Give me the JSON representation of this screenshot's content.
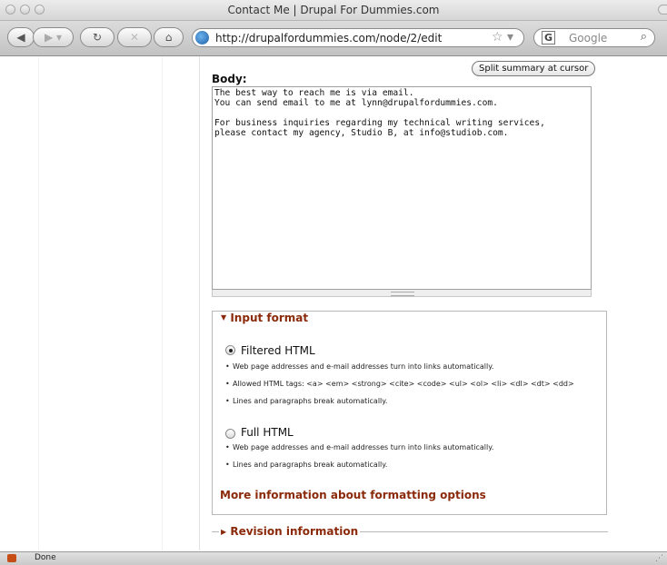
{
  "window": {
    "title": "Contact Me | Drupal For Dummies.com"
  },
  "toolbar": {
    "back_icon": "back-arrow-icon",
    "forward_icon": "forward-arrow-icon",
    "reload_icon": "reload-icon",
    "stop_icon": "stop-icon",
    "home_icon": "home-icon",
    "url": "http://drupalfordummies.com/node/2/edit",
    "search_placeholder": "Google"
  },
  "editor": {
    "split_button": "Split summary at cursor",
    "body_label": "Body:",
    "body_value": "The best way to reach me is via email.\nYou can send email to me at lynn@drupalfordummies.com.\n\nFor business inquiries regarding my technical writing services,\nplease contact my agency, Studio B, at info@studiob.com."
  },
  "input_format": {
    "legend": "Input format",
    "options": [
      {
        "label": "Filtered HTML",
        "selected": true,
        "tips": [
          "Web page addresses and e-mail addresses turn into links automatically.",
          "Allowed HTML tags: <a> <em> <strong> <cite> <code> <ul> <ol> <li> <dl> <dt> <dd>",
          "Lines and paragraphs break automatically."
        ]
      },
      {
        "label": "Full HTML",
        "selected": false,
        "tips": [
          "Web page addresses and e-mail addresses turn into links automatically.",
          "Lines and paragraphs break automatically."
        ]
      }
    ],
    "more_link": "More information about formatting options"
  },
  "revision": {
    "legend": "Revision information"
  },
  "status": {
    "text": "Done"
  }
}
